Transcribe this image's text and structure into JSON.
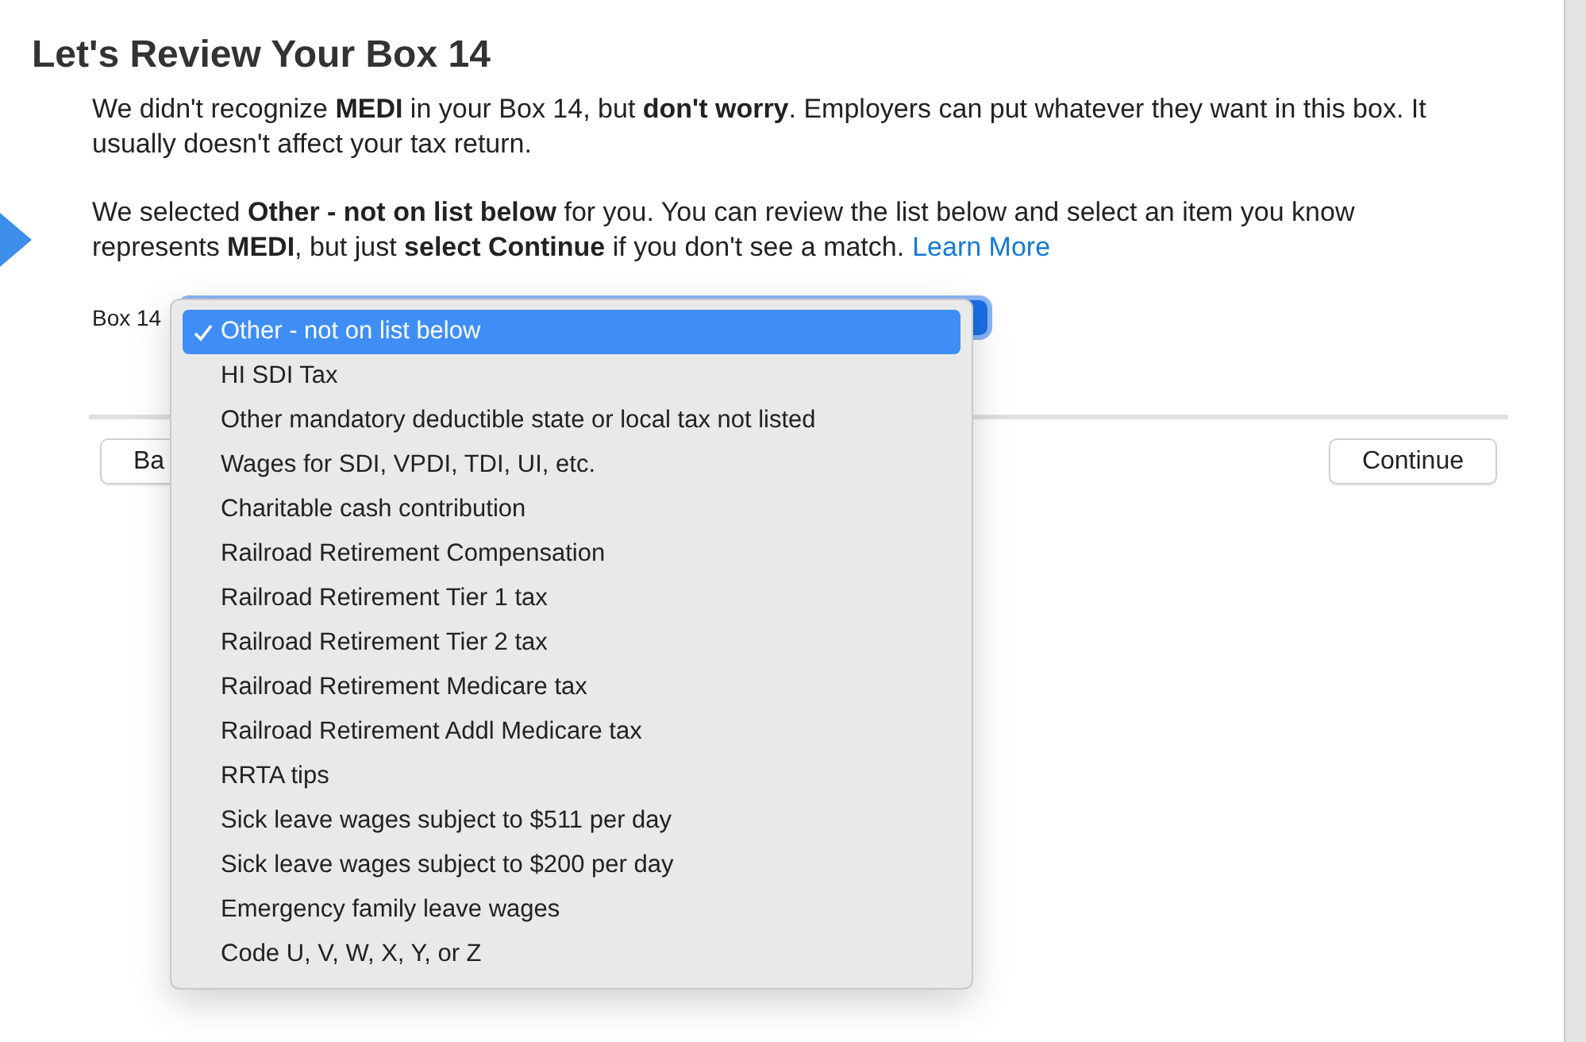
{
  "title": "Let's Review Your Box 14",
  "paragraphs": [
    {
      "text": "We didn't recognize **MEDI** in your Box 14, but **don't worry**. Employers can put whatever they want in this box. It usually doesn't affect your tax return."
    },
    {
      "text": "We selected **Other - not on list below** for you. You can review the list below and select an item you know represents **MEDI**, but just **select Continue** if you don't see a match.",
      "link": "Learn More"
    }
  ],
  "field_label": "Box 14",
  "menu": [
    {
      "label": "Other - not on list below",
      "selected": true
    },
    {
      "label": "HI SDI Tax",
      "selected": false
    },
    {
      "label": "Other mandatory deductible state or local tax not listed",
      "selected": false
    },
    {
      "label": "Wages for SDI, VPDI, TDI, UI, etc.",
      "selected": false
    },
    {
      "label": "Charitable cash contribution",
      "selected": false
    },
    {
      "label": "Railroad Retirement Compensation",
      "selected": false
    },
    {
      "label": "Railroad Retirement Tier 1 tax",
      "selected": false
    },
    {
      "label": "Railroad Retirement Tier 2 tax",
      "selected": false
    },
    {
      "label": "Railroad Retirement Medicare tax",
      "selected": false
    },
    {
      "label": "Railroad Retirement Addl Medicare tax",
      "selected": false
    },
    {
      "label": "RRTA tips",
      "selected": false
    },
    {
      "label": "Sick leave wages subject to $511 per day",
      "selected": false
    },
    {
      "label": "Sick leave wages subject to $200 per day",
      "selected": false
    },
    {
      "label": "Emergency family leave wages",
      "selected": false
    },
    {
      "label": "Code U, V, W, X, Y, or Z",
      "selected": false
    }
  ],
  "buttons": {
    "back": "Ba",
    "continue": "Continue"
  }
}
